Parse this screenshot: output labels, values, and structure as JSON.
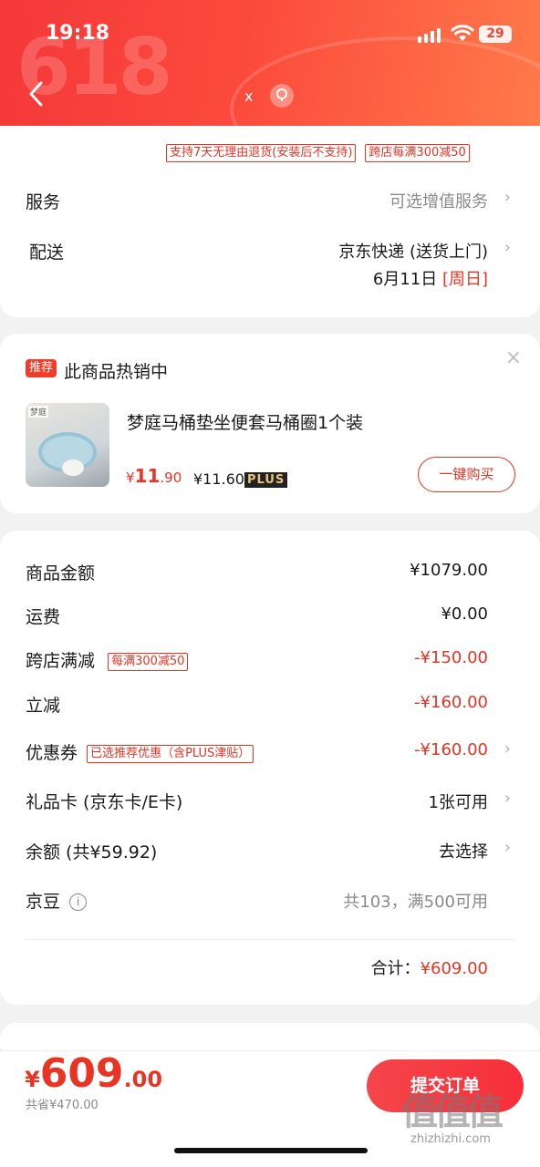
{
  "status_bar": {
    "time": "19:18",
    "battery": "29"
  },
  "header": {
    "bg_text": "618",
    "close_label": "x"
  },
  "card1": {
    "tags": [
      "支持7天无理由退货(安装后不支持)",
      "跨店每满300减50"
    ],
    "service_label": "服务",
    "service_value": "可选增值服务",
    "delivery_label": "配送",
    "delivery_value": "京东快递 (送货上门)",
    "delivery_date": "6月11日",
    "delivery_day": "[周日]"
  },
  "recommend": {
    "badge": "推荐",
    "title": "此商品热销中",
    "product_name": "梦庭马桶垫坐便套马桶圈1个装",
    "product_img_label": "梦庭",
    "price_yen": "¥",
    "price_int": "11",
    "price_dec": ".90",
    "plus_price": "¥11.60",
    "plus_badge": "PLUS",
    "buy_label": "一键购买"
  },
  "summary": {
    "rows": [
      {
        "label": "商品金额",
        "value": "¥1079.00"
      },
      {
        "label": "运费",
        "value": "¥0.00"
      },
      {
        "label": "跨店满减",
        "tag": "每满300减50",
        "value": "-¥150.00"
      },
      {
        "label": "立减",
        "value": "-¥160.00"
      },
      {
        "label": "优惠券",
        "tag": "已选推荐优惠（含PLUS津贴）",
        "value": "-¥160.00"
      },
      {
        "label": "礼品卡 (京东卡/E卡)",
        "value": "1张可用"
      },
      {
        "label": "余额 (共¥59.92)",
        "value": "去选择"
      },
      {
        "label": "京豆",
        "value": "共103，满500可用"
      }
    ],
    "total_label": "合计：",
    "total_value": "¥609.00"
  },
  "bottom": {
    "yen": "¥",
    "price_int": "609",
    "price_dec": ".00",
    "saved": "共省¥470.00",
    "submit_label": "提交订单"
  },
  "watermark": {
    "big": "值值值",
    "small": "zhizhizhi.com"
  },
  "colors": {
    "accent": "#e93323",
    "header": "#f5383a"
  }
}
